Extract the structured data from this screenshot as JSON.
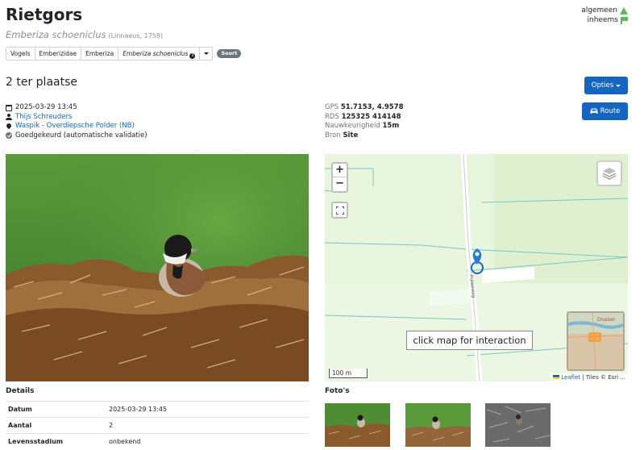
{
  "header": {
    "title": "Rietgors",
    "scientific_name": "Emberiza schoeniclus",
    "authority": "(Linnaeus, 1758)",
    "status_1": "algemeen",
    "status_2": "inheems"
  },
  "breadcrumb": {
    "items": [
      "Vogels",
      "Emberizidae",
      "Emberiza",
      "Emberiza schoeniclus"
    ],
    "info_glyph": "i",
    "badge": "Soort"
  },
  "observation": {
    "heading": "2 ter plaatse",
    "options_label": "Opties",
    "route_label": "Route",
    "datetime": "2025-03-29 13:45",
    "observer": "Thijs Schreuders",
    "location": "Waspik - Overdiepsche Polder (NB)",
    "validation": "Goedgekeurd (automatische validatie)"
  },
  "coords": {
    "gps_label": "GPS",
    "gps_value": "51.7153, 4.9578",
    "rds_label": "RDS",
    "rds_value": "125325 414148",
    "acc_label": "Nauwkeurigheid",
    "acc_value": "15m",
    "src_label": "Bron",
    "src_value": "Site"
  },
  "map": {
    "zoom_in": "+",
    "zoom_out": "−",
    "road_label": "Polderweg",
    "interaction_hint": "click map for interaction",
    "scale": "100 m",
    "minimap_label": "Drussen",
    "attribution_link": "Leaflet",
    "attribution_rest": " | Tiles © Esri ..."
  },
  "details": {
    "heading": "Details",
    "rows": [
      {
        "key": "Datum",
        "value": "2025-03-29 13:45"
      },
      {
        "key": "Aantal",
        "value": "2"
      },
      {
        "key": "Levensstadium",
        "value": "onbekend"
      }
    ]
  },
  "photos": {
    "heading": "Foto's"
  },
  "colors": {
    "accent": "#1565c0",
    "status_green": "#5cb85c",
    "badge_grey": "#6c757d"
  }
}
